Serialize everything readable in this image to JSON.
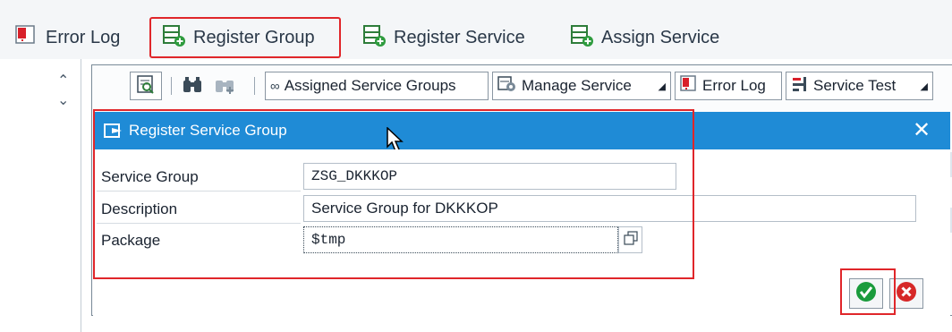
{
  "toolbar": {
    "error_log": "Error Log",
    "register_group": "Register Group",
    "register_service": "Register Service",
    "assign_service": "Assign Service"
  },
  "subtoolbar": {
    "assigned_service_groups": "Assigned Service Groups",
    "manage_service": "Manage Service",
    "error_log": "Error Log",
    "service_test": "Service Test"
  },
  "dialog": {
    "title": "Register Service Group",
    "fields": {
      "service_group_label": "Service Group",
      "service_group_value": "ZSG_DKKKOP",
      "description_label": "Description",
      "description_value": "Service Group for DKKKOP",
      "package_label": "Package",
      "package_value": "$tmp"
    }
  },
  "colors": {
    "title_bar": "#1f8bd6",
    "highlight": "#e0262a",
    "confirm": "#1a9b3c",
    "cancel": "#d62828"
  }
}
